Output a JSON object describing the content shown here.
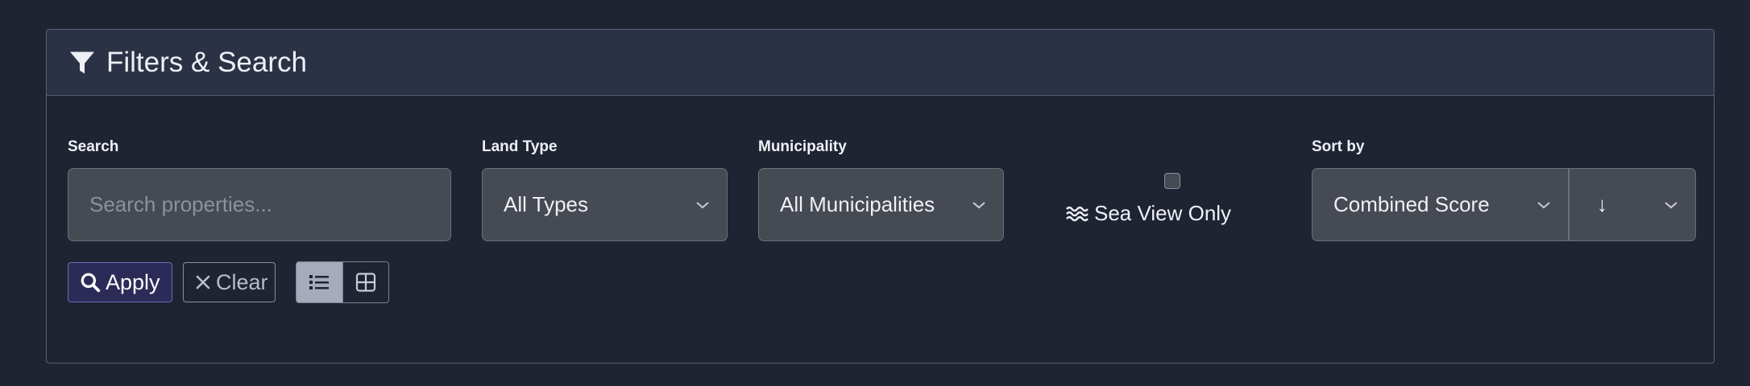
{
  "panel": {
    "title": "Filters & Search",
    "title_icon": "filter-icon"
  },
  "filters": {
    "search": {
      "label": "Search",
      "placeholder": "Search properties...",
      "value": ""
    },
    "land_type": {
      "label": "Land Type",
      "selected": "All Types"
    },
    "municipality": {
      "label": "Municipality",
      "selected": "All Municipalities"
    },
    "sea_view": {
      "label": "Sea View Only",
      "checked": false,
      "icon": "water-waves-icon"
    },
    "sort": {
      "label": "Sort by",
      "selected": "Combined Score",
      "direction": "↓"
    }
  },
  "actions": {
    "apply_label": "Apply",
    "clear_label": "Clear"
  },
  "view_toggle": {
    "active": "list",
    "options": [
      "list",
      "grid"
    ]
  },
  "colors": {
    "background": "#1f2432",
    "header": "#2c3246",
    "control": "#464a53",
    "apply_bg": "#2c2b57",
    "apply_border": "#6d6ab8",
    "toggle_active": "#a6aabb"
  }
}
